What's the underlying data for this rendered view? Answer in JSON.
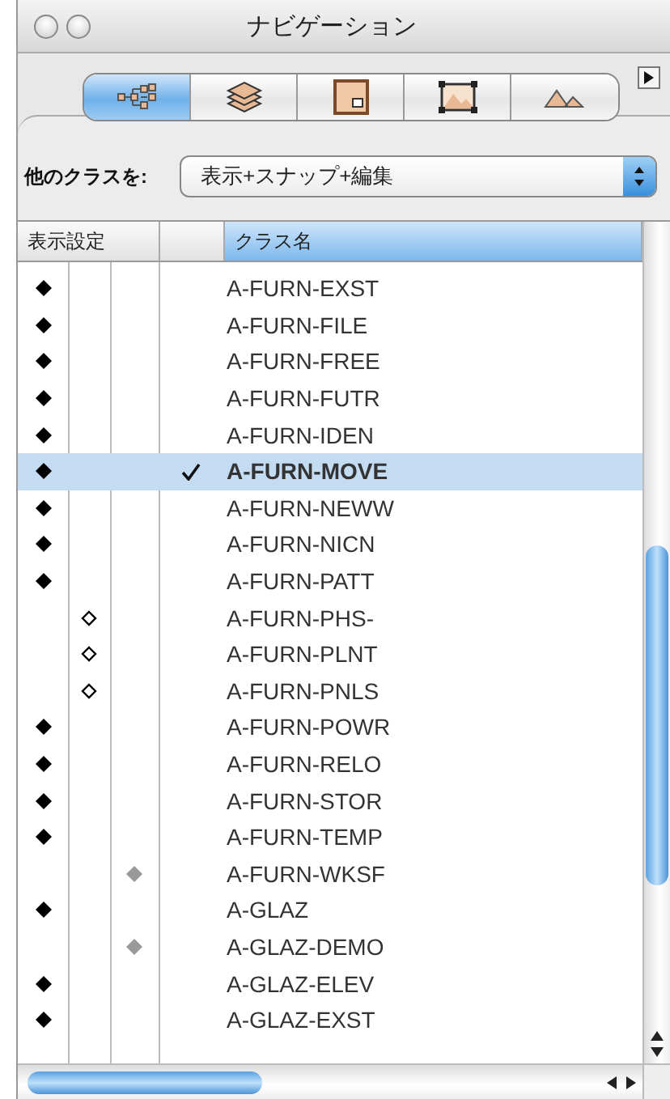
{
  "window": {
    "title": "ナビゲーション"
  },
  "tabs": [
    {
      "kind": "hierarchy",
      "selected": true
    },
    {
      "kind": "stack",
      "selected": false
    },
    {
      "kind": "sheet",
      "selected": false
    },
    {
      "kind": "viewport",
      "selected": false
    },
    {
      "kind": "terrain",
      "selected": false
    }
  ],
  "filter": {
    "label": "他のクラスを:",
    "value": "表示+スナップ+編集"
  },
  "table": {
    "columns": [
      {
        "label": "表示設定",
        "sorted": false
      },
      {
        "label": "クラス名",
        "sorted": true
      }
    ],
    "rows": [
      {
        "name": "A-FURN-EXST",
        "kind": "visible",
        "active": false,
        "selected": false
      },
      {
        "name": "A-FURN-FILE",
        "kind": "visible",
        "active": false,
        "selected": false
      },
      {
        "name": "A-FURN-FREE",
        "kind": "visible",
        "active": false,
        "selected": false
      },
      {
        "name": "A-FURN-FUTR",
        "kind": "visible",
        "active": false,
        "selected": false
      },
      {
        "name": "A-FURN-IDEN",
        "kind": "visible",
        "active": false,
        "selected": false
      },
      {
        "name": "A-FURN-MOVE",
        "kind": "visible",
        "active": true,
        "selected": true
      },
      {
        "name": "A-FURN-NEWW",
        "kind": "visible",
        "active": false,
        "selected": false
      },
      {
        "name": "A-FURN-NICN",
        "kind": "visible",
        "active": false,
        "selected": false
      },
      {
        "name": "A-FURN-PATT",
        "kind": "visible",
        "active": false,
        "selected": false
      },
      {
        "name": "A-FURN-PHS-",
        "kind": "invisible",
        "active": false,
        "selected": false
      },
      {
        "name": "A-FURN-PLNT",
        "kind": "invisible",
        "active": false,
        "selected": false
      },
      {
        "name": "A-FURN-PNLS",
        "kind": "invisible",
        "active": false,
        "selected": false
      },
      {
        "name": "A-FURN-POWR",
        "kind": "visible",
        "active": false,
        "selected": false
      },
      {
        "name": "A-FURN-RELO",
        "kind": "visible",
        "active": false,
        "selected": false
      },
      {
        "name": "A-FURN-STOR",
        "kind": "visible",
        "active": false,
        "selected": false
      },
      {
        "name": "A-FURN-TEMP",
        "kind": "visible",
        "active": false,
        "selected": false
      },
      {
        "name": "A-FURN-WKSF",
        "kind": "grayed",
        "active": false,
        "selected": false
      },
      {
        "name": "A-GLAZ",
        "kind": "visible",
        "active": false,
        "selected": false
      },
      {
        "name": "A-GLAZ-DEMO",
        "kind": "grayed",
        "active": false,
        "selected": false
      },
      {
        "name": "A-GLAZ-ELEV",
        "kind": "visible",
        "active": false,
        "selected": false
      },
      {
        "name": "A-GLAZ-EXST",
        "kind": "visible",
        "active": false,
        "selected": false
      }
    ]
  }
}
